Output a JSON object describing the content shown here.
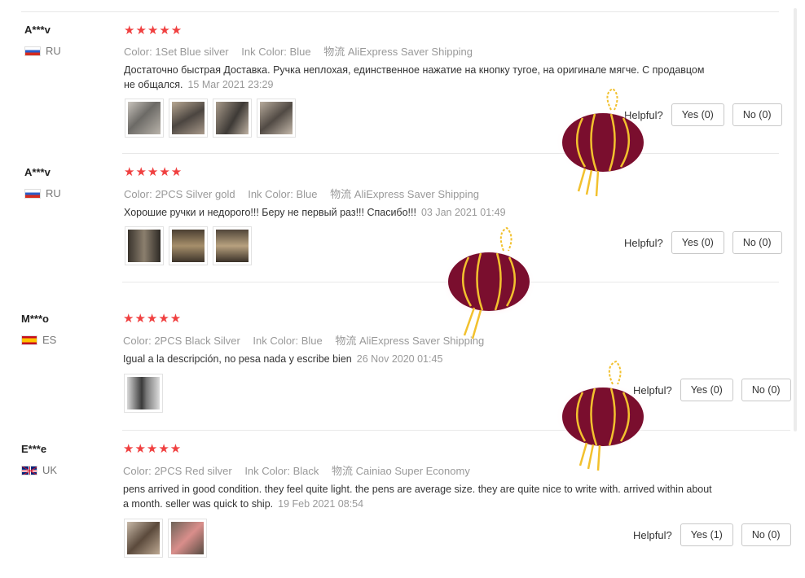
{
  "labels": {
    "helpful": "Helpful?",
    "color": "Color:",
    "ink": "Ink Color:",
    "ship": "物流"
  },
  "reviews": [
    {
      "name": "A***v",
      "country": "RU",
      "stars": "★★★★★",
      "color": "1Set Blue silver",
      "ink": "Blue",
      "shipping": "AliExpress Saver Shipping",
      "text": "Достаточно быстрая Доставка. Ручка неплохая, единственное нажатие на кнопку тугое, на оригинале мягче. С продавцом не общался.",
      "date": "15 Mar 2021 23:29",
      "yes": "Yes (0)",
      "no": "No (0)"
    },
    {
      "name": "A***v",
      "country": "RU",
      "stars": "★★★★★",
      "color": "2PCS Silver gold",
      "ink": "Blue",
      "shipping": "AliExpress Saver Shipping",
      "text": "Хорошие ручки и недорого!!! Беру не первый раз!!! Спасибо!!!",
      "date": "03 Jan 2021 01:49",
      "yes": "Yes (0)",
      "no": "No (0)"
    },
    {
      "name": "M***o",
      "country": "ES",
      "stars": "★★★★★",
      "color": "2PCS Black Silver",
      "ink": "Blue",
      "shipping": "AliExpress Saver Shipping",
      "text": "Igual a la descripción, no pesa nada y escribe bien",
      "date": "26 Nov 2020 01:45",
      "yes": "Yes (0)",
      "no": "No (0)"
    },
    {
      "name": "E***e",
      "country": "UK",
      "stars": "★★★★★",
      "color": "2PCS Red silver",
      "ink": "Black",
      "shipping": "Cainiao Super Economy",
      "text": "pens arrived in good condition. they feel quite light. the pens are average size. they are quite nice to write with. arrived within about a month. seller was quick to ship.",
      "date": "19 Feb 2021 08:54",
      "yes": "Yes (1)",
      "no": "No (0)"
    }
  ],
  "colors": {
    "star": "#f04040",
    "lantern": "#7a0e2e",
    "lantern_trim": "#f2c12e"
  }
}
